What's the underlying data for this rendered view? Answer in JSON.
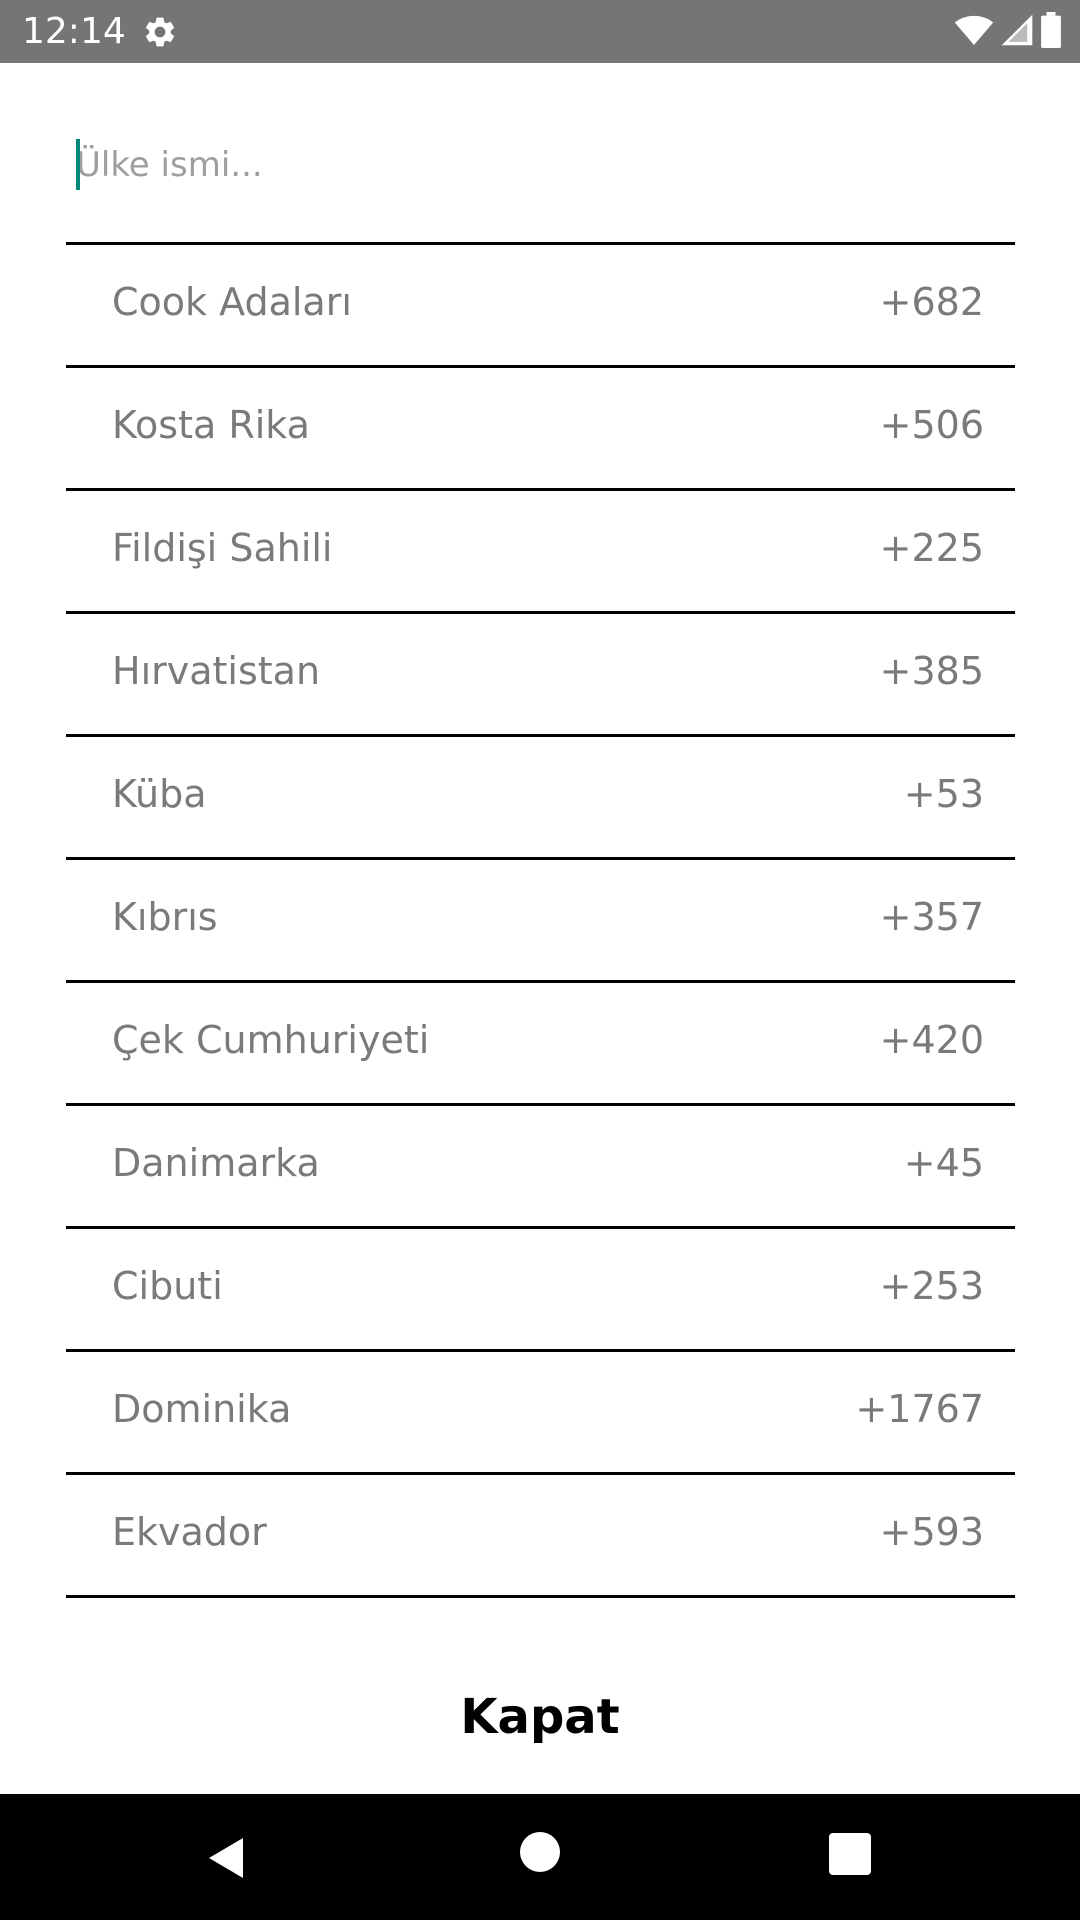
{
  "status_bar": {
    "time": "12:14",
    "icons": [
      "gear-icon",
      "wifi-icon",
      "signal-icon",
      "battery-icon"
    ]
  },
  "search": {
    "placeholder": "Ülke ismi...",
    "value": ""
  },
  "countries": [
    {
      "name": "Cook Adaları",
      "code": "+682"
    },
    {
      "name": "Kosta Rika",
      "code": "+506"
    },
    {
      "name": "Fildişi Sahili",
      "code": "+225"
    },
    {
      "name": "Hırvatistan",
      "code": "+385"
    },
    {
      "name": "Küba",
      "code": "+53"
    },
    {
      "name": "Kıbrıs",
      "code": "+357"
    },
    {
      "name": "Çek Cumhuriyeti",
      "code": "+420"
    },
    {
      "name": "Danimarka",
      "code": "+45"
    },
    {
      "name": "Cibuti",
      "code": "+253"
    },
    {
      "name": "Dominika",
      "code": "+1767"
    },
    {
      "name": "Ekvador",
      "code": "+593"
    }
  ],
  "close_button": {
    "label": "Kapat"
  },
  "nav_bar": {
    "icons": [
      "back-icon",
      "home-icon",
      "recents-icon"
    ]
  },
  "colors": {
    "status_bar": "#757575",
    "accent_cursor": "#00897b",
    "text_secondary": "#7a7a7a",
    "divider": "#000000",
    "nav_bar": "#000000"
  }
}
